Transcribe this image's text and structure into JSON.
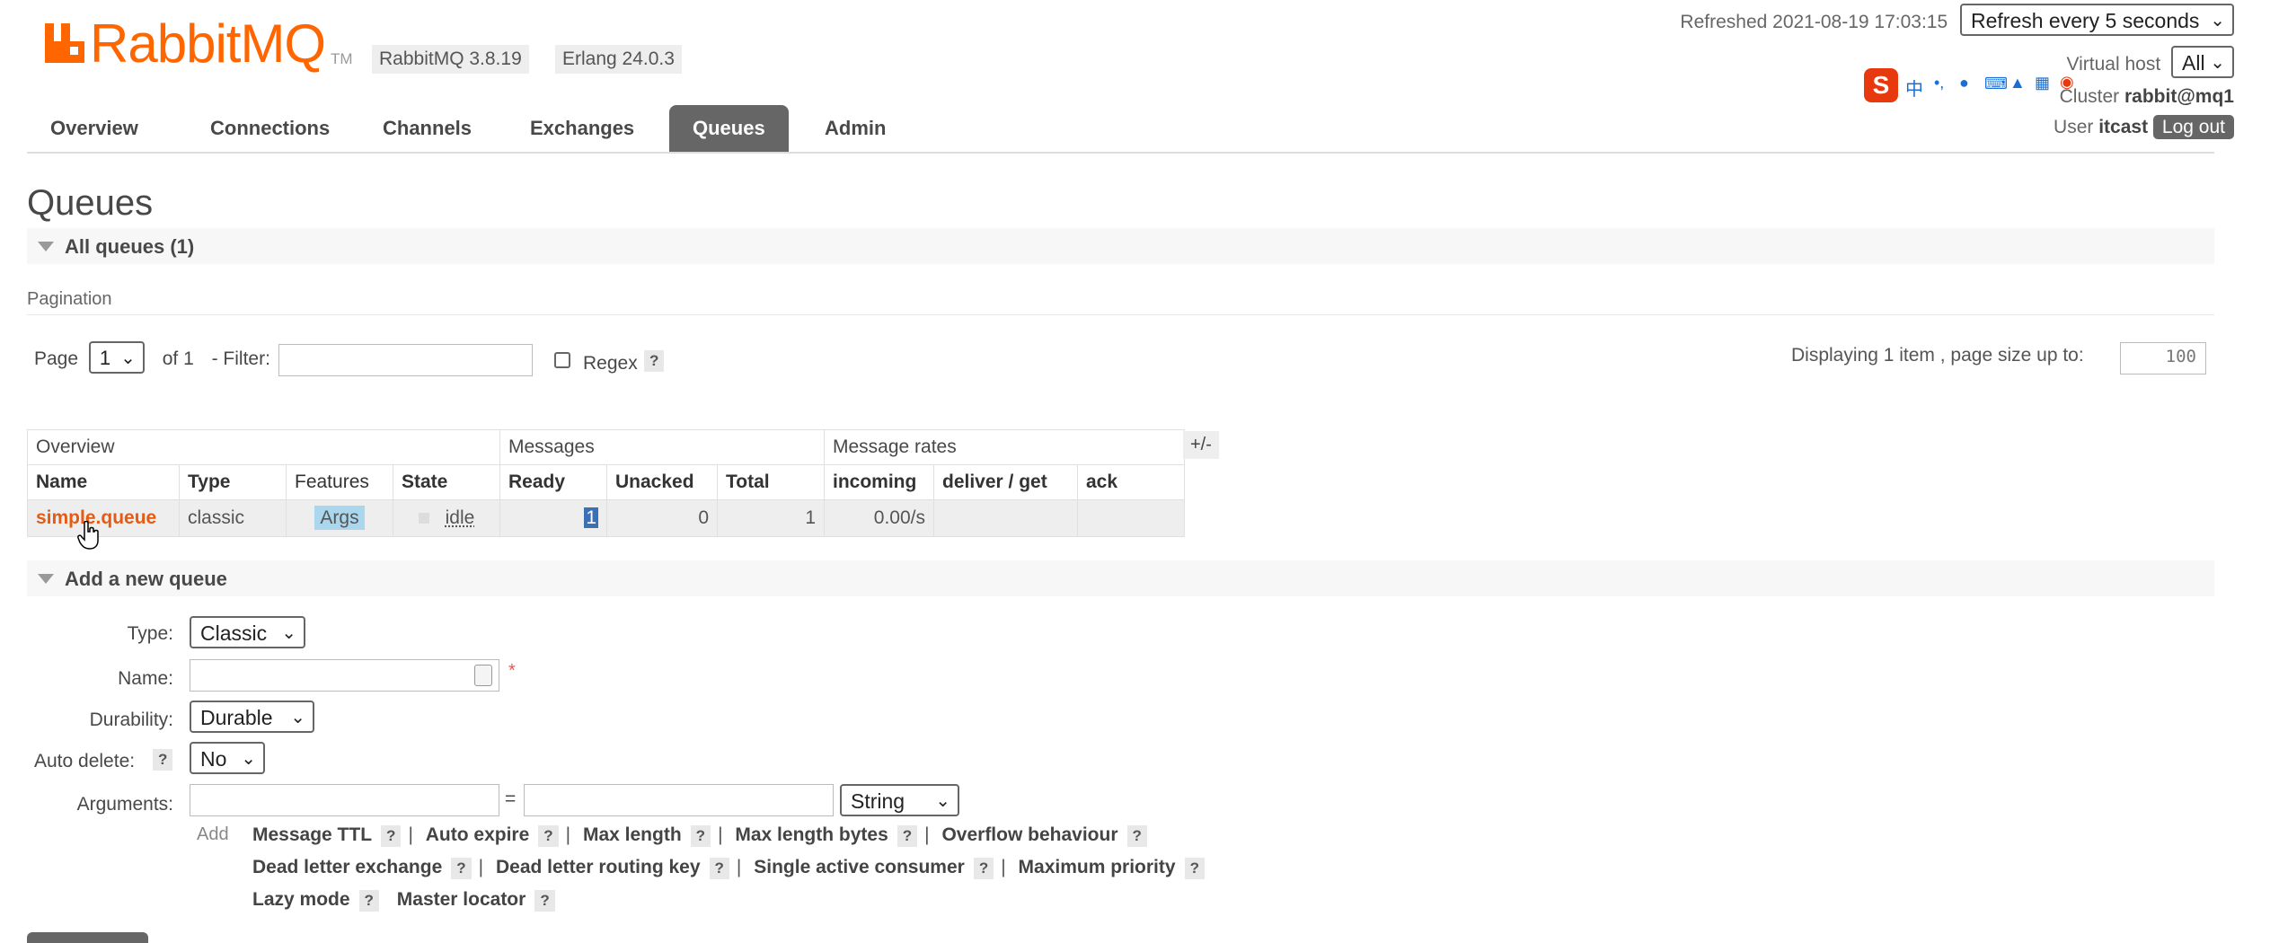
{
  "brand": {
    "logo_text": "RabbitMQ",
    "logo_tm": "TM",
    "version_badge": "RabbitMQ 3.8.19",
    "erlang_badge": "Erlang 24.0.3",
    "color": "#f60"
  },
  "header": {
    "refreshed_label": "Refreshed 2021-08-19 17:03:15",
    "refresh_select": "Refresh every 5 seconds",
    "vhost_label": "Virtual host",
    "vhost_select": "All",
    "cluster_label": "Cluster",
    "cluster_name": "rabbit@mq1",
    "user_label": "User",
    "user_name": "itcast",
    "logout_label": "Log out"
  },
  "nav": {
    "tabs": [
      {
        "label": "Overview",
        "active": false
      },
      {
        "label": "Connections",
        "active": false
      },
      {
        "label": "Channels",
        "active": false
      },
      {
        "label": "Exchanges",
        "active": false
      },
      {
        "label": "Queues",
        "active": true
      },
      {
        "label": "Admin",
        "active": false
      }
    ]
  },
  "main": {
    "title": "Queues",
    "all_queues_label": "All queues (1)",
    "pagination": {
      "label": "Pagination",
      "page_label": "Page",
      "page_value": "1",
      "of_label": "of 1",
      "filter_label": "- Filter:",
      "filter_value": "",
      "regex_label": "Regex",
      "help": "?",
      "displaying": "Displaying 1 item , page size up to:",
      "page_size": "100"
    },
    "table": {
      "group_headers": [
        "Overview",
        "Messages",
        "Message rates"
      ],
      "plus_minus": "+/-",
      "columns": [
        "Name",
        "Type",
        "Features",
        "State",
        "Ready",
        "Unacked",
        "Total",
        "incoming",
        "deliver / get",
        "ack"
      ],
      "rows": [
        {
          "name": "simple.queue",
          "type": "classic",
          "features": "Args",
          "state": "idle",
          "ready": "1",
          "unacked": "0",
          "total": "1",
          "incoming": "0.00/s",
          "deliver_get": "",
          "ack": ""
        }
      ]
    }
  },
  "add_queue": {
    "section_label": "Add a new queue",
    "type_label": "Type:",
    "type_value": "Classic",
    "name_label": "Name:",
    "name_value": "",
    "required_mark": "*",
    "durability_label": "Durability:",
    "durability_value": "Durable",
    "auto_delete_label": "Auto delete:",
    "auto_delete_value": "No",
    "arguments_label": "Arguments:",
    "equals": "=",
    "arg_type_value": "String",
    "add_label": "Add",
    "arg_lines": [
      [
        "Message TTL",
        "Auto expire",
        "Max length",
        "Max length bytes",
        "Overflow behaviour"
      ],
      [
        "Dead letter exchange",
        "Dead letter routing key",
        "Single active consumer",
        "Maximum priority"
      ],
      [
        "Lazy mode",
        "Master locator"
      ]
    ]
  },
  "ime_toolbar": {
    "label": "中"
  }
}
